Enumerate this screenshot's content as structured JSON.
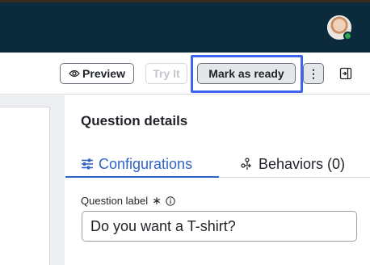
{
  "header": {
    "avatar_icon": "user-avatar-icon",
    "status_color": "#2fa44f",
    "background_color": "#0b2a3c"
  },
  "toolbar": {
    "preview_label": "Preview",
    "preview_icon": "eye-icon",
    "tryit_label": "Try It",
    "ready_label": "Mark as ready",
    "more_label": "⋮",
    "collapse_icon": "collapse-panel-icon",
    "focus_color": "#3f64f0"
  },
  "panel": {
    "title": "Question details",
    "tabs": [
      {
        "label": "Configurations",
        "icon": "sliders-icon",
        "active": true
      },
      {
        "label": "Behaviors (0)",
        "icon": "behaviors-icon",
        "active": false
      }
    ],
    "accent_color": "#2f63c8",
    "field": {
      "label": "Question label",
      "required_mark": "∗",
      "info_icon": "info-icon",
      "value": "Do you want a T-shirt?"
    }
  }
}
